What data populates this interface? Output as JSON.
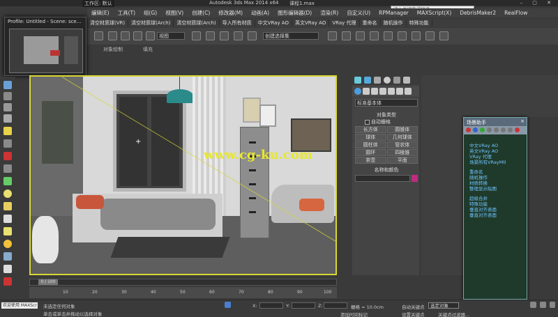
{
  "window": {
    "title": "Autodesk 3ds Max 2014 x64",
    "file": "课程1.max",
    "workspace": "工作区: 默认"
  },
  "search": {
    "placeholder": "键入关键字或短语"
  },
  "profile_popup": {
    "title": "Profile: Untitled - Scene: sce..."
  },
  "menu": [
    "编辑(E)",
    "工具(T)",
    "组(G)",
    "视图(V)",
    "创建(C)",
    "修改器(M)",
    "动画(A)",
    "图形编辑器(D)",
    "渲染(R)",
    "自定义(U)",
    "RPManager",
    "MAXScript(X)",
    "DebrisMaker2",
    "RealFlow"
  ],
  "menu2": [
    "清空材质球(VR)",
    "清空材质球(Arch)",
    "清空材质球(Arch)",
    "导入所有材质",
    "中文VRay AO",
    "英文VRay AO",
    "VRay 代理",
    "重命名",
    "随机操作",
    "特殊功能"
  ],
  "toolbar": {
    "view_select": "视图",
    "named_select": "创建选择集"
  },
  "subrow": {
    "a": "对象绘制",
    "b": "填充"
  },
  "viewport": {
    "label": "+",
    "watermark": "www.cg-ku.com"
  },
  "command_panel": {
    "dropdown": "标准基本体",
    "group1_title": "对象类型",
    "autogrid": "自动栅格",
    "objects": [
      "长方体",
      "圆锥体",
      "球体",
      "几何球体",
      "圆柱体",
      "管状体",
      "圆环",
      "四棱锥",
      "茶壶",
      "平面"
    ],
    "group2_title": "名称和颜色"
  },
  "assistant": {
    "title": "场景助手",
    "close": "×",
    "items_a": [
      "中文VRay AO",
      "英文VRay AO",
      "VRay 代理",
      "场景所有VRayMtl"
    ],
    "items_b": [
      "重命名",
      "随机操作",
      "材质转换",
      "整理显示贴图"
    ],
    "items_c": [
      "超级合并",
      "特殊功能",
      "垂直对齐表面",
      "垂直对齐表面"
    ]
  },
  "timeline": {
    "frame": "0 / 100",
    "ticks": [
      "10",
      "20",
      "30",
      "40",
      "50",
      "60",
      "70",
      "80",
      "90",
      "100"
    ]
  },
  "status": {
    "welcome": "欢迎使用 MAXScr",
    "line1": "未选定任何对象",
    "line2": "单击或单击并拖动以选择对象",
    "x_label": "X:",
    "y_label": "Y:",
    "z_label": "Z:",
    "grid": "栅格 = 10.0cm",
    "auto_key": "自动关键点",
    "selected": "选定对象",
    "set_key": "设置关键点",
    "add_time_tag": "添加时间标记",
    "key_filter": "关键点过滤器..."
  },
  "colors": {
    "viewport_border": "#d7d733",
    "assist_text": "#6fc3ff",
    "watermark": "#e8e82a"
  }
}
